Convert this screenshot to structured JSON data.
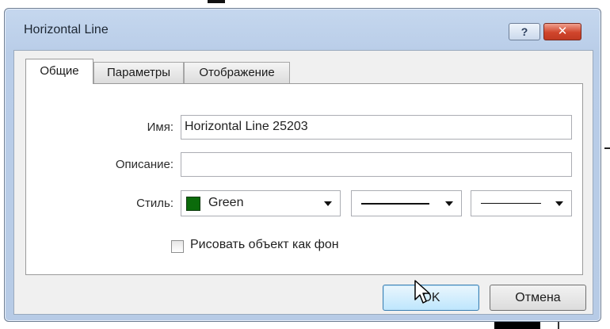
{
  "window": {
    "title": "Horizontal Line",
    "help_glyph": "?",
    "close_glyph": "✕"
  },
  "tabs": [
    {
      "label": "Общие",
      "active": true
    },
    {
      "label": "Параметры",
      "active": false
    },
    {
      "label": "Отображение",
      "active": false
    }
  ],
  "form": {
    "name_label": "Имя:",
    "name_value": "Horizontal Line 25203",
    "description_label": "Описание:",
    "description_value": "",
    "style_label": "Стиль:",
    "color_value": "Green",
    "color_swatch": "#0b6b0b",
    "line_style_icon": "solid-line",
    "line_width_icon": "thin-line",
    "background_checkbox_label": "Рисовать объект как фон",
    "background_checked": false
  },
  "buttons": {
    "ok_label": "OK",
    "cancel_label": "Отмена"
  }
}
